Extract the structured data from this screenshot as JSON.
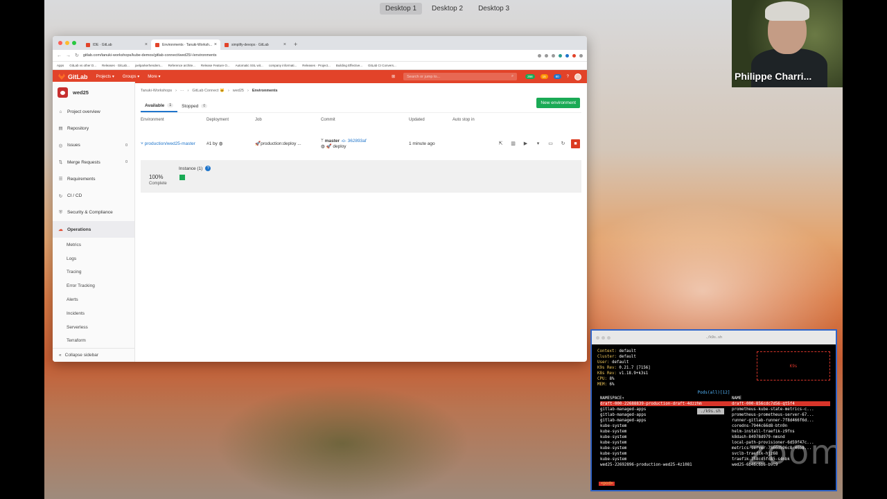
{
  "desktops": [
    "Desktop 1",
    "Desktop 2",
    "Desktop 3"
  ],
  "webcam": {
    "name": "Philippe Charri..."
  },
  "browser": {
    "tabs": [
      {
        "label": "IDE · GitLab"
      },
      {
        "label": "Environments · Tanuki-Worksh..."
      },
      {
        "label": "simplify-devops · GitLab"
      }
    ],
    "new_tab": "+",
    "url": "gitlab.com/tanuki-workshops/kube-demos/gitlab-connect/wed25/-/environments",
    "bookmarks": [
      "Apps",
      "GitLab vs other D...",
      "Releases · GitLab...",
      "joelparkerhenders...",
      "Reference archite...",
      "Release Feature O...",
      "Automatic SSL wit...",
      "company informati...",
      "Releases · Project...",
      "Building Effective...",
      "GitLab CI Convers..."
    ]
  },
  "gitlab": {
    "logo": "GitLab",
    "nav": [
      "Projects ▾",
      "Groups ▾",
      "More ▾"
    ],
    "search_placeholder": "Search or jump to...",
    "badge_counts": [
      "268",
      "15",
      "80"
    ],
    "project_name": "wed25",
    "sidebar": [
      {
        "label": "Project overview",
        "icon": "⌂",
        "count": ""
      },
      {
        "label": "Repository",
        "icon": "▤",
        "count": ""
      },
      {
        "label": "Issues",
        "icon": "◎",
        "count": "0"
      },
      {
        "label": "Merge Requests",
        "icon": "⇅",
        "count": "0"
      },
      {
        "label": "Requirements",
        "icon": "☰",
        "count": ""
      },
      {
        "label": "CI / CD",
        "icon": "↻",
        "count": ""
      },
      {
        "label": "Security & Compliance",
        "icon": "⛨",
        "count": ""
      },
      {
        "label": "Operations",
        "icon": "☁",
        "count": ""
      }
    ],
    "operations_sub": [
      "Metrics",
      "Logs",
      "Tracing",
      "Error Tracking",
      "Alerts",
      "Incidents",
      "Serverless",
      "Terraform"
    ],
    "collapse_label": "Collapse sidebar",
    "breadcrumb": [
      "Tanuki-Workshops",
      "···",
      "GitLab Connect 🐱",
      "wed25",
      "Environments"
    ],
    "env_tabs": [
      {
        "label": "Available",
        "count": "1"
      },
      {
        "label": "Stopped",
        "count": "0"
      }
    ],
    "new_env_button": "New environment",
    "columns": [
      "Environment",
      "Deployment",
      "Job",
      "Commit",
      "Updated",
      "Auto stop in"
    ],
    "row": {
      "environment": "production/wed25-master",
      "deployment": "#1 by",
      "job": "production:deploy ...",
      "commit_branch": "master",
      "commit_sha": "-o- 362893af",
      "commit_msg": "deploy",
      "updated": "1 minute ago"
    },
    "deploy_panel": {
      "percent": "100%",
      "percent_label": "Complete",
      "instances": "Instance (1)",
      "help": "?"
    }
  },
  "terminal": {
    "title": "./k9s.sh",
    "info": [
      [
        "Context:",
        "default"
      ],
      [
        "Cluster:",
        "default"
      ],
      [
        "User:",
        "default"
      ],
      [
        "K9s Rev:",
        "0.21.7 [7156]"
      ],
      [
        "K8s Rev:",
        "v1.18.9+k3s1"
      ],
      [
        "CPU:",
        "8%"
      ],
      [
        "MEM:",
        "6%"
      ]
    ],
    "pods_title": "Pods(all)[12]",
    "namespace_header": "NAMESPACE↑",
    "name_header": "NAME",
    "namespaces": [
      "draft-000-22688839-production-draft-4dzzhm",
      "gitlab-managed-apps",
      "gitlab-managed-apps",
      "gitlab-managed-apps",
      "kube-system",
      "kube-system",
      "kube-system",
      "kube-system",
      "kube-system",
      "kube-system",
      "kube-system",
      "wed25-22692896-production-wed25-4z1081"
    ],
    "names": [
      "draft-000-856cdc7d56-qt5f4",
      "prometheus-kube-state-metrics-c...",
      "prometheus-prometheus-server-67...",
      "runner-gitlab-runner-7f8d466f6d...",
      "coredns-7944c66d8-btn9n",
      "helm-install-traefik-z9fns",
      "k8dash-84978d979-nmsnd",
      "local-path-provisioner-6d59f47c...",
      "metrics-server-7566d596c8-46b8...",
      "svclb-traefik-hjz68",
      "traefik-758cd5fc85-s4nbk",
      "wed25-6b46c6b6-b9t9"
    ],
    "k9s_tag": "./k9s.sh",
    "prompt": "<pod>",
    "watermark": "zoom"
  }
}
